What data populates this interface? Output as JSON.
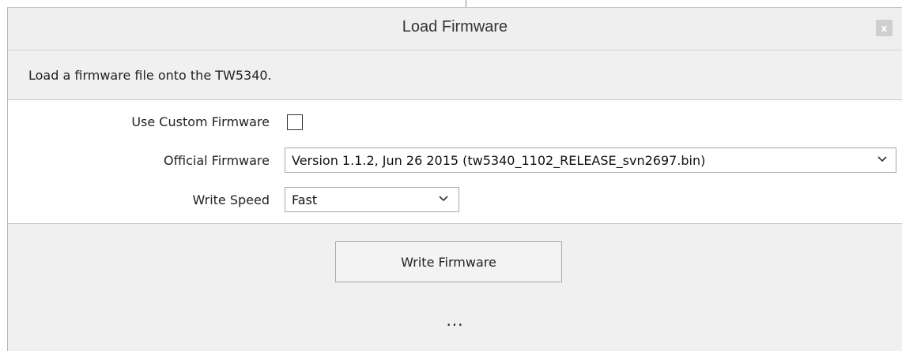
{
  "dialog": {
    "title": "Load Firmware",
    "close_label": "x"
  },
  "description": "Load a firmware file onto the TW5340.",
  "form": {
    "custom_firmware_label": "Use Custom Firmware",
    "custom_firmware_checked": false,
    "official_firmware_label": "Official Firmware",
    "official_firmware_value": "Version 1.1.2, Jun 26 2015 (tw5340_1102_RELEASE_svn2697.bin)",
    "write_speed_label": "Write Speed",
    "write_speed_value": "Fast"
  },
  "actions": {
    "write_button_label": "Write Firmware"
  },
  "status_text": "...",
  "icons": {
    "dropdown": "chevron-down-icon",
    "close": "close-icon"
  }
}
